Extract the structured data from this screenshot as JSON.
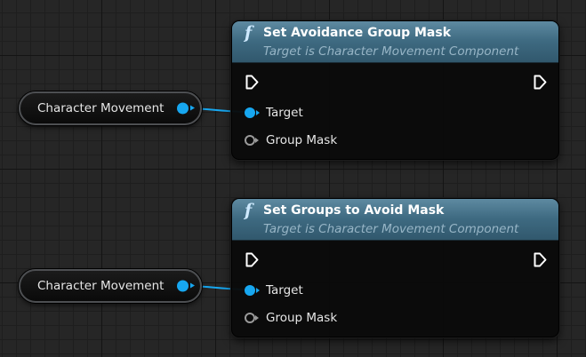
{
  "graph": {
    "variable_nodes": [
      {
        "label": "Character Movement"
      },
      {
        "label": "Character Movement"
      }
    ],
    "function_nodes": [
      {
        "icon": "f",
        "title": "Set Avoidance Group Mask",
        "subtitle": "Target is Character Movement Component",
        "pins": {
          "target": "Target",
          "group_mask": "Group Mask"
        }
      },
      {
        "icon": "f",
        "title": "Set Groups to Avoid Mask",
        "subtitle": "Target is Character Movement Component",
        "pins": {
          "target": "Target",
          "group_mask": "Group Mask"
        }
      }
    ]
  },
  "colors": {
    "object_pin": "#17a7f0",
    "struct_pin_outline": "#9a9a9a",
    "function_header": "#4a7890",
    "graph_background": "#262626"
  }
}
